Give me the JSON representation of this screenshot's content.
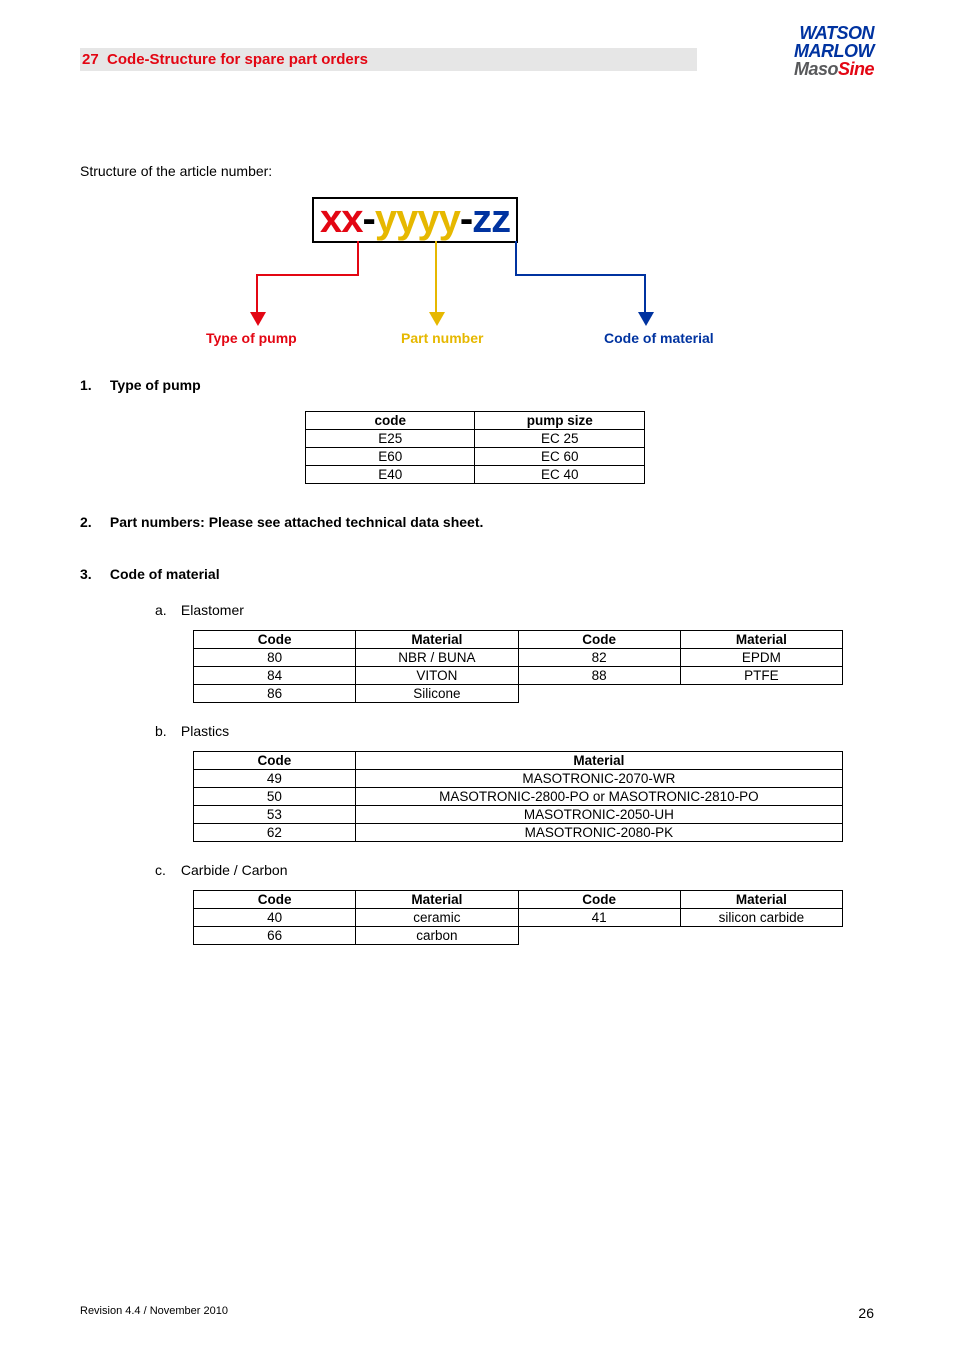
{
  "header": {
    "section_number": "27",
    "section_title": "Code-Structure for spare part orders",
    "logo": {
      "line1": "WATSON",
      "line2": "MARLOW",
      "line3a": "Maso",
      "line3b": "Sine"
    }
  },
  "intro": "Structure of the article number:",
  "diagram": {
    "code": {
      "xx": "xx",
      "dash1": "-",
      "yyyy": "yyyy",
      "dash2": "-",
      "zz": "zz"
    },
    "labels": {
      "type": "Type of pump",
      "part": "Part number",
      "material": "Code of material"
    }
  },
  "sections": {
    "one": {
      "num": "1.",
      "title": "Type of pump"
    },
    "two": {
      "num": "2.",
      "title": "Part numbers: Please see attached technical data sheet."
    },
    "three": {
      "num": "3.",
      "title": "Code of material"
    }
  },
  "pump_table": {
    "headers": {
      "code": "code",
      "size": "pump size"
    },
    "rows": [
      {
        "code": "E25",
        "size": "EC 25"
      },
      {
        "code": "E60",
        "size": "EC 60"
      },
      {
        "code": "E40",
        "size": "EC 40"
      }
    ]
  },
  "sub": {
    "a": {
      "lett": "a.",
      "label": "Elastomer"
    },
    "b": {
      "lett": "b.",
      "label": "Plastics"
    },
    "c": {
      "lett": "c.",
      "label": "Carbide / Carbon"
    }
  },
  "elastomer": {
    "headers": {
      "code": "Code",
      "material": "Material"
    },
    "rows": [
      {
        "c1": "80",
        "m1": "NBR / BUNA",
        "c2": "82",
        "m2": "EPDM"
      },
      {
        "c1": "84",
        "m1": "VITON",
        "c2": "88",
        "m2": "PTFE"
      },
      {
        "c1": "86",
        "m1": "Silicone",
        "c2": "",
        "m2": ""
      }
    ]
  },
  "plastics": {
    "headers": {
      "code": "Code",
      "material": "Material"
    },
    "rows": [
      {
        "code": "49",
        "material": "MASOTRONIC-2070-WR"
      },
      {
        "code": "50",
        "material": "MASOTRONIC-2800-PO or MASOTRONIC-2810-PO"
      },
      {
        "code": "53",
        "material": "MASOTRONIC-2050-UH"
      },
      {
        "code": "62",
        "material": "MASOTRONIC-2080-PK"
      }
    ]
  },
  "carbide": {
    "headers": {
      "code": "Code",
      "material": "Material"
    },
    "rows": [
      {
        "c1": "40",
        "m1": "ceramic",
        "c2": "41",
        "m2": "silicon carbide"
      },
      {
        "c1": "66",
        "m1": "carbon",
        "c2": "",
        "m2": ""
      }
    ]
  },
  "footer": {
    "revision": "Revision 4.4 / November 2010",
    "page": "26"
  }
}
